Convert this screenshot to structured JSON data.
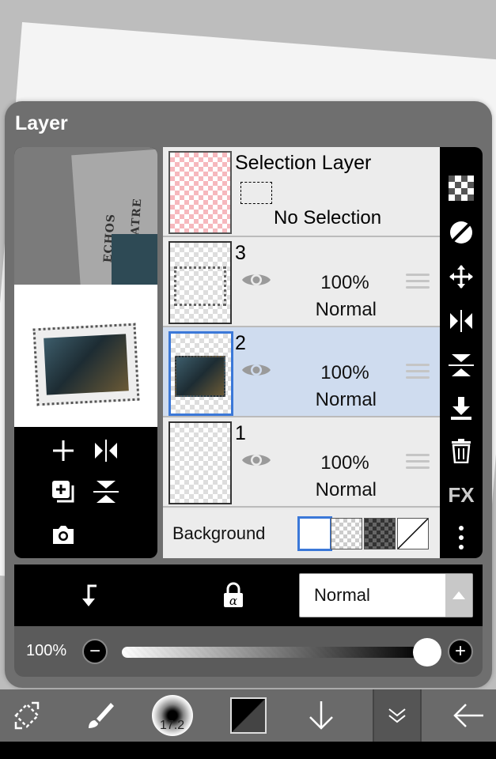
{
  "dialog": {
    "title": "Layer"
  },
  "preview": {
    "newspaper_text": "ECHOS du THEATRE"
  },
  "layers": {
    "selection": {
      "title": "Selection Layer",
      "status": "No Selection"
    },
    "items": [
      {
        "name": "3",
        "opacity": "100%",
        "blend": "Normal",
        "selected": false
      },
      {
        "name": "2",
        "opacity": "100%",
        "blend": "Normal",
        "selected": true
      },
      {
        "name": "1",
        "opacity": "100%",
        "blend": "Normal",
        "selected": false
      }
    ],
    "background": {
      "label": "Background"
    }
  },
  "right_tools": {
    "fx_label": "FX"
  },
  "action_bar": {
    "blend_mode": "Normal"
  },
  "opacity_slider": {
    "label": "100%",
    "value": 1.0
  },
  "bottom_toolbar": {
    "brush_size": "17.2"
  },
  "colors": {
    "selected_highlight": "#cfdcef",
    "selected_border": "#3b78d8",
    "panel": "#6f6f6f"
  }
}
